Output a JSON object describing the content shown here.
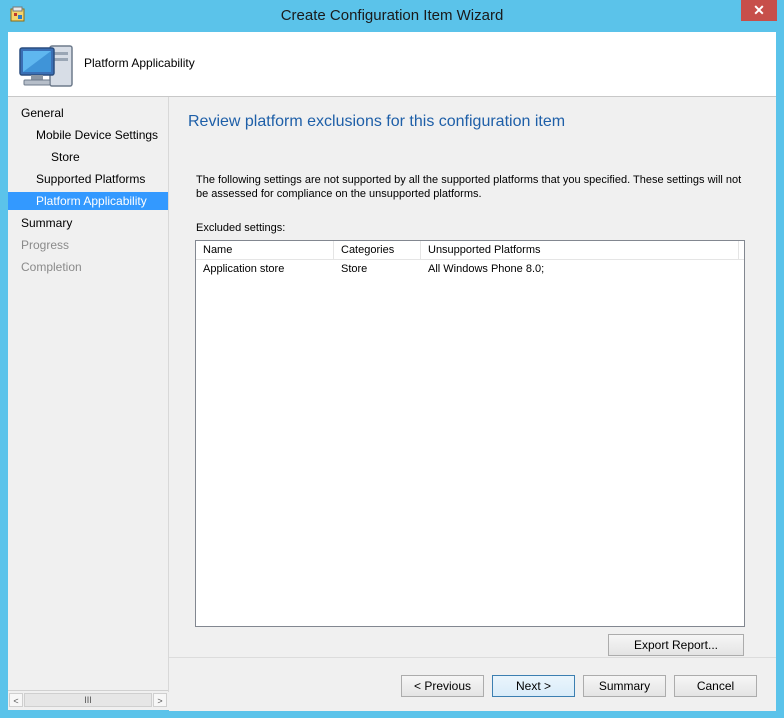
{
  "window": {
    "title": "Create Configuration Item Wizard",
    "close_glyph": "✕",
    "icon": "wizard-app-icon"
  },
  "header": {
    "title": "Platform Applicability",
    "icon": "computer-monitor-icon"
  },
  "nav": {
    "items": [
      {
        "label": "General",
        "state": "normal",
        "indent": 0
      },
      {
        "label": "Mobile Device Settings",
        "state": "normal",
        "indent": 1
      },
      {
        "label": "Store",
        "state": "normal",
        "indent": 2
      },
      {
        "label": "Supported Platforms",
        "state": "normal",
        "indent": 1
      },
      {
        "label": "Platform Applicability",
        "state": "active",
        "indent": 1
      },
      {
        "label": "Summary",
        "state": "normal",
        "indent": 0
      },
      {
        "label": "Progress",
        "state": "disabled",
        "indent": 0
      },
      {
        "label": "Completion",
        "state": "disabled",
        "indent": 0
      }
    ],
    "scroll_left": "<",
    "scroll_thumb": "III",
    "scroll_right": ">"
  },
  "main": {
    "heading": "Review platform exclusions for this configuration item",
    "description": "The following settings are not supported by all the supported platforms that you specified. These settings will not be assessed for compliance on the unsupported platforms.",
    "excluded_label": "Excluded settings:",
    "table": {
      "columns": [
        "Name",
        "Categories",
        "Unsupported Platforms"
      ],
      "rows": [
        [
          "Application store",
          "Store",
          "All Windows Phone 8.0;"
        ]
      ]
    },
    "export_button": "Export Report..."
  },
  "footer": {
    "previous": "< Previous",
    "next": "Next >",
    "summary": "Summary",
    "cancel": "Cancel"
  },
  "colors": {
    "titlebar": "#5bc3ea",
    "accent": "#3399ff",
    "heading": "#1e5fa8",
    "close": "#c74f4a"
  }
}
